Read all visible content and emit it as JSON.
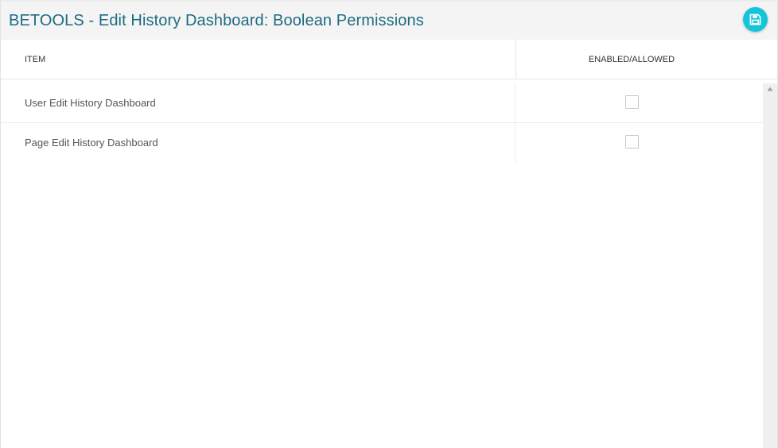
{
  "header": {
    "title": "BETOOLS - Edit History Dashboard: Boolean Permissions",
    "save_icon": "floppy-disk-icon",
    "accent_color": "#13c5da",
    "title_color": "#1e6b83"
  },
  "table": {
    "columns": [
      "ITEM",
      "ENABLED/ALLOWED"
    ],
    "rows": [
      {
        "item": "User Edit History Dashboard",
        "enabled": false
      },
      {
        "item": "Page Edit History Dashboard",
        "enabled": false
      }
    ]
  }
}
